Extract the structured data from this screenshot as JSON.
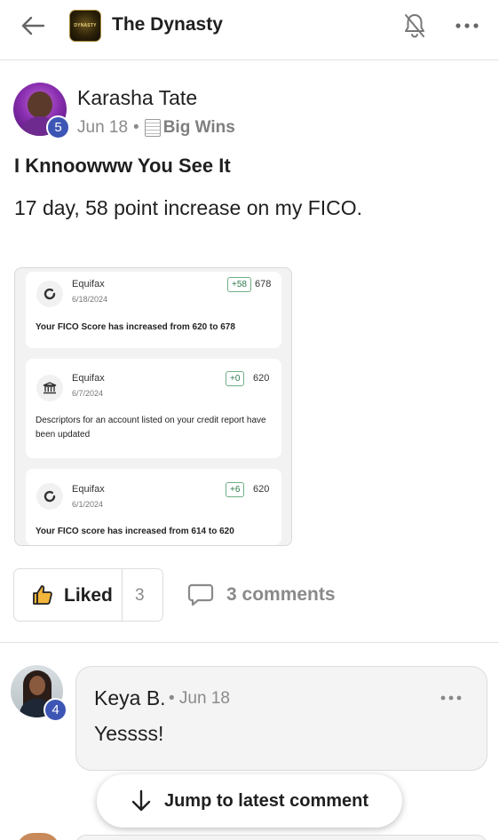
{
  "header": {
    "group_name": "The Dynasty",
    "logo_text": "DYNASTY"
  },
  "post": {
    "author": "Karasha Tate",
    "author_level": "5",
    "date": "Jun 18",
    "separator": "•",
    "category": "Big Wins",
    "title": "I Knnoowww You See It",
    "body": "17 day, 58 point increase on my FICO.",
    "attachment": {
      "cards": [
        {
          "source": "Equifax",
          "date": "6/18/2024",
          "delta": "+58",
          "score": "678",
          "description": "Your FICO Score has increased from 620 to 678",
          "icon": "score-ring-icon"
        },
        {
          "source": "Equifax",
          "date": "6/7/2024",
          "delta": "+0",
          "score": "620",
          "description": "Descriptors for an account listed on your credit report have been updated",
          "icon": "bank-icon"
        },
        {
          "source": "Equifax",
          "date": "6/1/2024",
          "delta": "+6",
          "score": "620",
          "description": "Your FICO score has increased from 614 to 620",
          "icon": "score-ring-icon"
        }
      ]
    },
    "actions": {
      "like_label": "Liked",
      "like_count": "3",
      "comments_label": "3 comments"
    }
  },
  "comment": {
    "author": "Keya B.",
    "author_level": "4",
    "date": "• Jun 18",
    "text": "Yessss!"
  },
  "jump_button": {
    "label": "Jump to latest comment"
  },
  "colors": {
    "badge": "#3d55b5",
    "delta_border": "#6fae86",
    "text_primary": "#1f1f1f",
    "text_muted": "#8a8a8a"
  }
}
